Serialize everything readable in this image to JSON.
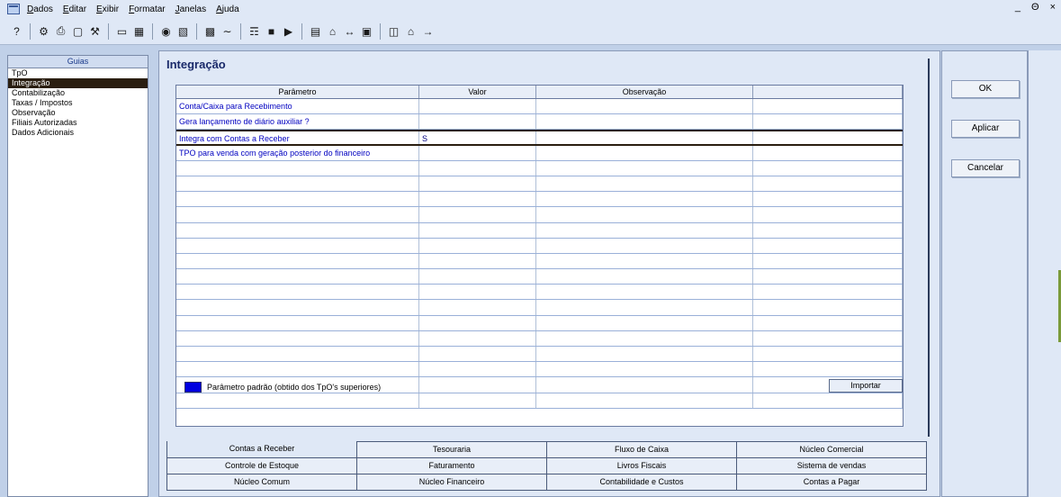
{
  "menu": [
    "Dados",
    "Editar",
    "Exibir",
    "Formatar",
    "Janelas",
    "Ajuda"
  ],
  "window_controls": [
    "_",
    "Θ",
    "×"
  ],
  "guias": {
    "header": "Guias",
    "items": [
      "TpO",
      "Integração",
      "Contabilização",
      "Taxas / Impostos",
      "Observação",
      "Filiais Autorizadas",
      "Dados Adicionais"
    ],
    "active_index": 1
  },
  "main": {
    "title": "Integração",
    "columns": [
      "Parâmetro",
      "Valor",
      "Observação",
      ""
    ],
    "rows": [
      {
        "param": "Conta/Caixa para Recebimento",
        "valor": "",
        "obs": "",
        "extra": ""
      },
      {
        "param": "Gera lançamento de diário auxiliar ?",
        "valor": "",
        "obs": "",
        "extra": ""
      },
      {
        "param": "Integra com Contas a Receber",
        "valor": "S",
        "obs": "",
        "extra": ""
      },
      {
        "param": "TPO para venda com geração posterior do financeiro",
        "valor": "",
        "obs": "",
        "extra": ""
      }
    ],
    "selected_row": 2,
    "legend": "Parâmetro padrão (obtido dos TpO's superiores)",
    "legend_color": "#0000e0",
    "import_label": "Importar"
  },
  "tabs": [
    [
      "Contas a Receber",
      "Tesouraria",
      "Fluxo de Caixa",
      "Núcleo Comercial"
    ],
    [
      "Controle de Estoque",
      "Faturamento",
      "Livros Fiscais",
      "Sistema de vendas"
    ],
    [
      "Núcleo Comum",
      "Núcleo Financeiro",
      "Contabilidade e Custos",
      "Contas a Pagar"
    ]
  ],
  "active_tab": "Contas a Receber",
  "buttons": {
    "ok": "OK",
    "aplicar": "Aplicar",
    "cancelar": "Cancelar"
  },
  "colors": {
    "selection": "#2a1e10",
    "param_text": "#0000c0",
    "background": "#dfe8f6"
  }
}
